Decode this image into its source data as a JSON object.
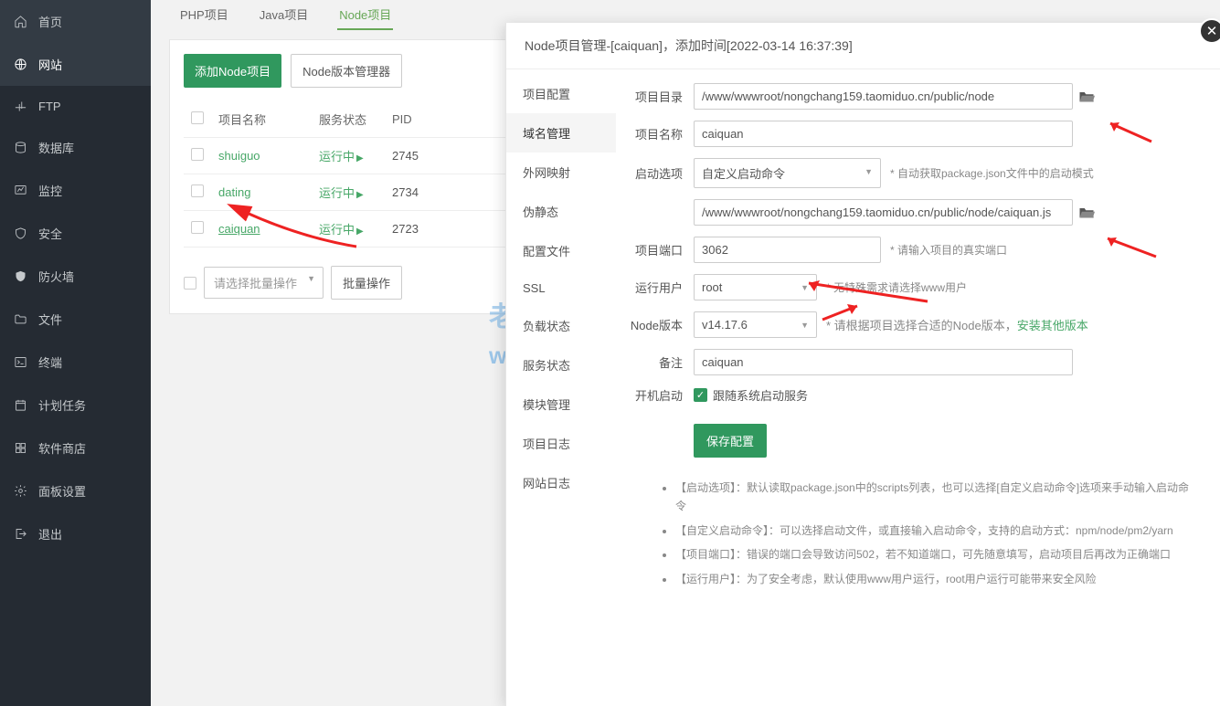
{
  "sidebar": {
    "items": [
      {
        "label": "首页"
      },
      {
        "label": "网站"
      },
      {
        "label": "FTP"
      },
      {
        "label": "数据库"
      },
      {
        "label": "监控"
      },
      {
        "label": "安全"
      },
      {
        "label": "防火墙"
      },
      {
        "label": "文件"
      },
      {
        "label": "终端"
      },
      {
        "label": "计划任务"
      },
      {
        "label": "软件商店"
      },
      {
        "label": "面板设置"
      },
      {
        "label": "退出"
      }
    ]
  },
  "tabs": {
    "t1": "PHP项目",
    "t2": "Java项目",
    "t3": "Node项目"
  },
  "toolbar": {
    "add": "添加Node项目",
    "ver": "Node版本管理器"
  },
  "table": {
    "h1": "项目名称",
    "h2": "服务状态",
    "h3": "PID",
    "rows": [
      {
        "name": "shuiguo",
        "status": "运行中",
        "pid": "2745"
      },
      {
        "name": "dating",
        "status": "运行中",
        "pid": "2734"
      },
      {
        "name": "caiquan",
        "status": "运行中",
        "pid": "2723"
      }
    ]
  },
  "batch": {
    "select": "请选择批量操作",
    "btn": "批量操作"
  },
  "modal": {
    "title": "Node项目管理-[caiquan]，添加时间[2022-03-14 16:37:39]",
    "side": [
      "项目配置",
      "域名管理",
      "外网映射",
      "伪静态",
      "配置文件",
      "SSL",
      "负载状态",
      "服务状态",
      "模块管理",
      "项目日志",
      "网站日志"
    ],
    "labels": {
      "dir": "项目目录",
      "name": "项目名称",
      "startOpt": "启动选项",
      "port": "项目端口",
      "user": "运行用户",
      "nodeVer": "Node版本",
      "remark": "备注",
      "boot": "开机启动"
    },
    "values": {
      "dir": "/www/wwwroot/nongchang159.taomiduo.cn/public/node",
      "name": "caiquan",
      "startOpt": "自定义启动命令",
      "startFile": "/www/wwwroot/nongchang159.taomiduo.cn/public/node/caiquan.js",
      "port": "3062",
      "user": "root",
      "nodeVer": "v14.17.6",
      "remark": "caiquan",
      "bootLabel": "跟随系统启动服务"
    },
    "hints": {
      "startOpt": "* 自动获取package.json文件中的启动模式",
      "port": "* 请输入项目的真实端口",
      "user": "* 无特殊需求请选择www用户",
      "nodeVer": "* 请根据项目选择合适的Node版本，",
      "nodeVerLink": "安装其他版本"
    },
    "save": "保存配置",
    "notes": [
      "【启动选项】：默认读取package.json中的scripts列表，也可以选择[自定义启动命令]选项来手动输入启动命令",
      "【自定义启动命令】：可以选择启动文件，或直接输入启动命令，支持的启动方式：npm/node/pm2/yarn",
      "【项目端口】：错误的端口会导致访问502，若不知道端口，可先随意填写，启动项目后再改为正确端口",
      "【运行用户】：为了安全考虑，默认使用www用户运行，root用户运行可能带来安全风险"
    ]
  },
  "watermark": {
    "l1": "老夹搭建教程",
    "l2": "weixiaolive.com"
  }
}
